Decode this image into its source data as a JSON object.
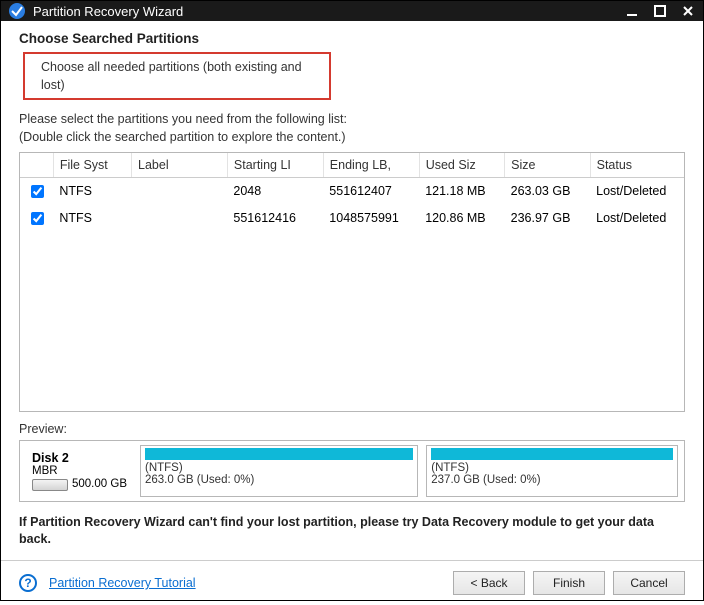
{
  "window": {
    "title": "Partition Recovery Wizard"
  },
  "heading": "Choose Searched Partitions",
  "subheading": "Choose all needed partitions (both existing and lost)",
  "instructions": {
    "line1": "Please select the partitions you need from the following list:",
    "line2": "(Double click the searched partition to explore the content.)"
  },
  "columns": {
    "chk": "",
    "fs": "File Syst",
    "label": "Label",
    "slba": "Starting LI",
    "elba": "Ending LB,",
    "used": "Used Siz",
    "size": "Size",
    "status": "Status"
  },
  "rows": [
    {
      "checked": true,
      "fs": "NTFS",
      "label": "",
      "slba": "2048",
      "elba": "551612407",
      "used": "121.18 MB",
      "size": "263.03 GB",
      "status": "Lost/Deleted"
    },
    {
      "checked": true,
      "fs": "NTFS",
      "label": "",
      "slba": "551612416",
      "elba": "1048575991",
      "used": "120.86 MB",
      "size": "236.97 GB",
      "status": "Lost/Deleted"
    }
  ],
  "preview": {
    "label": "Preview:",
    "disk": {
      "name": "Disk 2",
      "scheme": "MBR",
      "size": "500.00 GB"
    },
    "parts": [
      {
        "fs": "(NTFS)",
        "size": "263.0 GB (Used: 0%)",
        "flex": 263
      },
      {
        "fs": "(NTFS)",
        "size": "237.0 GB (Used: 0%)",
        "flex": 237
      }
    ]
  },
  "note": "If Partition Recovery Wizard can't find your lost partition, please try Data Recovery module to get your data back.",
  "tutorial": "Partition Recovery Tutorial",
  "buttons": {
    "back": "< Back",
    "finish": "Finish",
    "cancel": "Cancel"
  }
}
